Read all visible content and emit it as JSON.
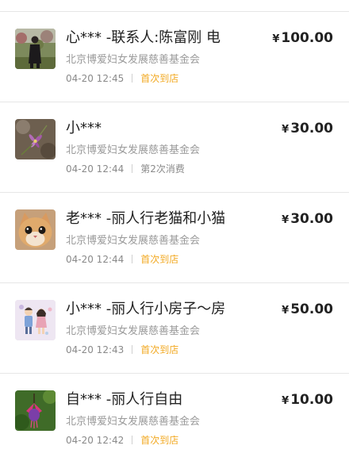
{
  "colors": {
    "title": "#222222",
    "org": "#9a9a9a",
    "meta": "#8a8a8a",
    "highlight_tag": "#f2a922",
    "divider": "#e6e6e6"
  },
  "currency_symbol": "¥",
  "transactions": [
    {
      "title": "心*** -联系人:陈富刚 电",
      "amount": "100.00",
      "org": "北京博爱妇女发展慈善基金会",
      "time": "04-20 12:45",
      "tag": "首次到店",
      "tag_type": "highlight",
      "avatar": "person-in-orchard-photo"
    },
    {
      "title": "小***",
      "amount": "30.00",
      "org": "北京博爱妇女发展慈善基金会",
      "time": "04-20 12:44",
      "tag": "第2次消费",
      "tag_type": "normal",
      "avatar": "purple-flower-photo"
    },
    {
      "title": "老*** -丽人行老猫和小猫",
      "amount": "30.00",
      "org": "北京博爱妇女发展慈善基金会",
      "time": "04-20 12:44",
      "tag": "首次到店",
      "tag_type": "highlight",
      "avatar": "cat-photo"
    },
    {
      "title": "小*** -丽人行小房子～房玮",
      "amount": "50.00",
      "org": "北京博爱妇女发展慈善基金会",
      "time": "04-20 12:43",
      "tag": "首次到店",
      "tag_type": "highlight",
      "avatar": "cartoon-couple-illustration"
    },
    {
      "title": "自*** -丽人行自由",
      "amount": "10.00",
      "org": "北京博爱妇女发展慈善基金会",
      "time": "04-20 12:42",
      "tag": "首次到店",
      "tag_type": "highlight",
      "avatar": "fuchsia-flower-photo"
    }
  ]
}
